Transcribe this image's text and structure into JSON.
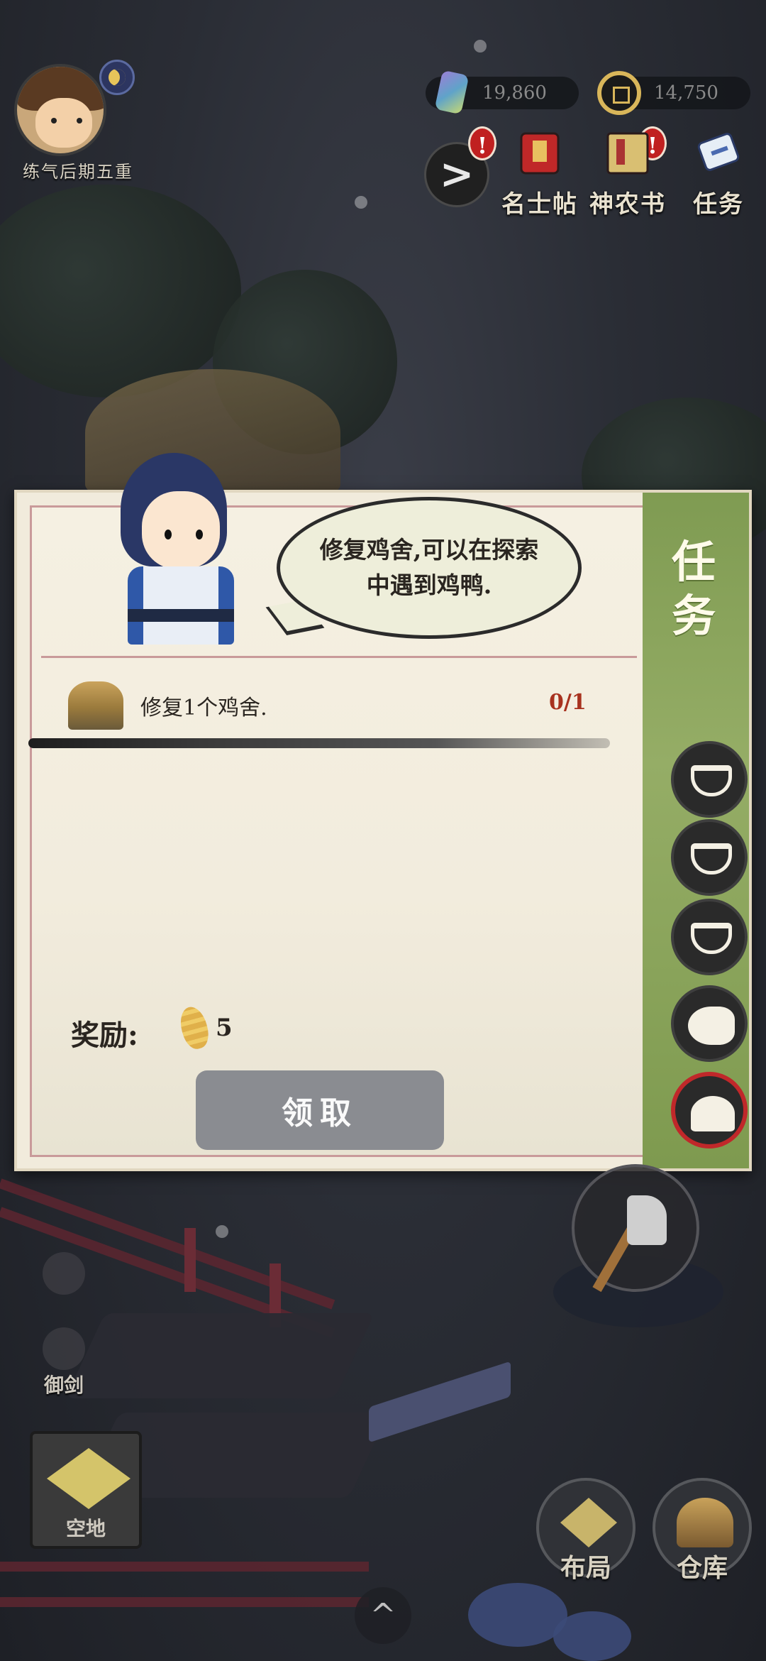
{
  "player": {
    "rank": "练气后期五重"
  },
  "currencies": {
    "jade": "19,860",
    "coins": "14,750"
  },
  "top_menu": {
    "expand_arrow": ">",
    "items": [
      {
        "label": "名士帖",
        "icon": "red-invitation-icon",
        "alert": "!"
      },
      {
        "label": "神农书",
        "icon": "book-icon",
        "alert": "!"
      },
      {
        "label": "任务",
        "icon": "scroll-icon"
      }
    ]
  },
  "task_panel": {
    "side_title": "任务",
    "dialogue": "修复鸡舍,可以在探索中遇到鸡鸭.",
    "task": {
      "description": "修复1个鸡舍.",
      "progress": "0/1",
      "icon": "chicken-coop-icon"
    },
    "reward": {
      "label": "奖励:",
      "icon": "corn-icon",
      "count": "5"
    },
    "claim_label": "领取",
    "tabs": [
      {
        "icon": "basket-icon",
        "active": false
      },
      {
        "icon": "basket-icon",
        "active": false
      },
      {
        "icon": "basket-icon",
        "active": false
      },
      {
        "icon": "fish-icon",
        "active": false
      },
      {
        "icon": "rice-icon",
        "active": true
      }
    ],
    "accent_color": "#8aa35a"
  },
  "bottom_controls": {
    "fly_sword_label": "御剑",
    "empty_plot_label": "空地",
    "layout_label": "布局",
    "warehouse_label": "仓库",
    "expand_up": "^"
  }
}
